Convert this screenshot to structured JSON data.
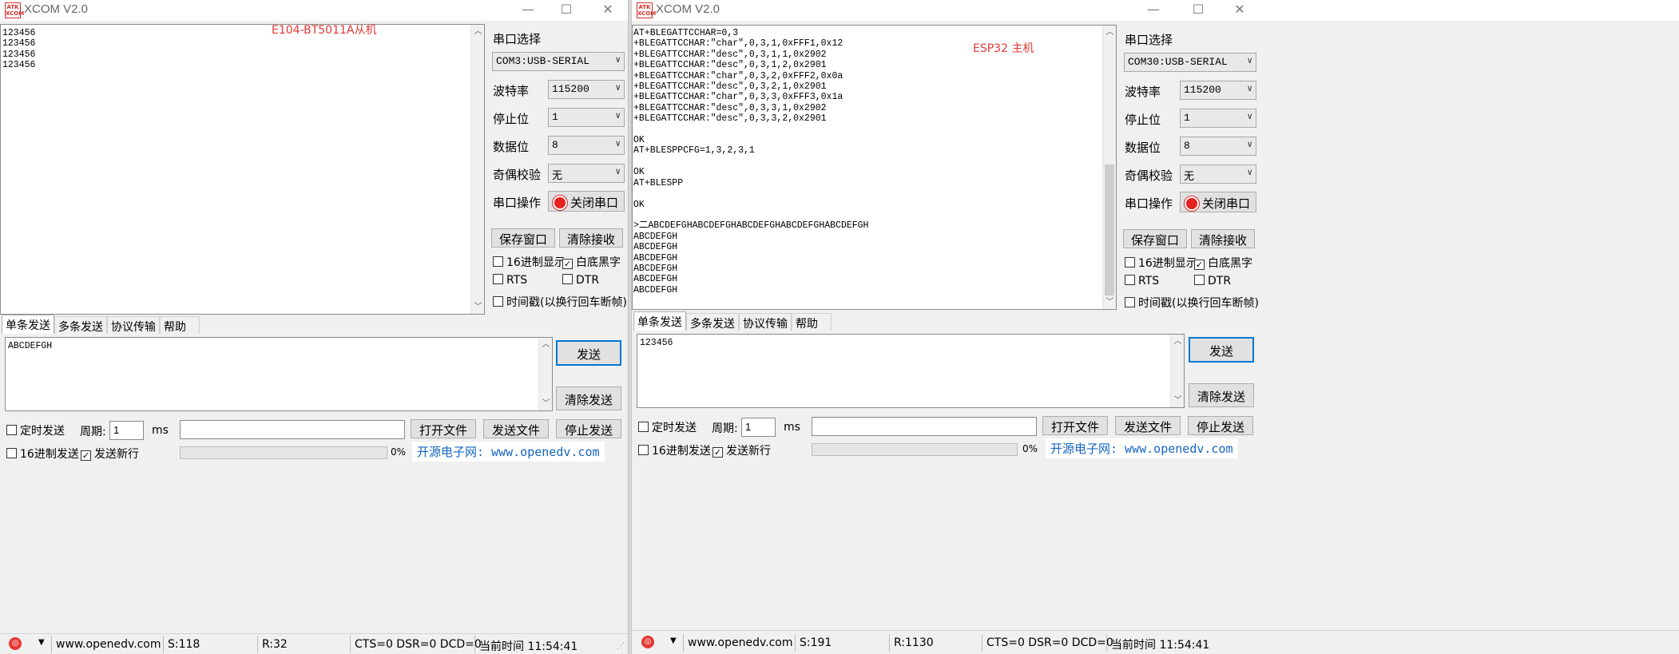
{
  "left": {
    "app": {
      "logo_text": "ATK XCOM",
      "title": "XCOM V2.0"
    },
    "titlebar_buttons": {
      "minimize": "—",
      "maximize": "☐",
      "close": "✕"
    },
    "overlay_label": "E104-BT5011A从机",
    "receive_lines": "123456\n123456\n123456\n123456",
    "settings": {
      "port_label": "串口选择",
      "port_value": "COM3:USB-SERIAL",
      "baud_label": "波特率",
      "baud_value": "115200",
      "stop_label": "停止位",
      "stop_value": "1",
      "data_label": "数据位",
      "data_value": "8",
      "parity_label": "奇偶校验",
      "parity_value": "无",
      "op_label": "串口操作",
      "close_port_label": "关闭串口",
      "save_window": "保存窗口",
      "clear_receive": "清除接收",
      "hex_display": "16进制显示",
      "white_bg": "白底黑字",
      "rts": "RTS",
      "dtr": "DTR",
      "timestamp": "时间戳(以换行回车断帧)"
    },
    "tabs": [
      "单条发送",
      "多条发送",
      "协议传输",
      "帮助"
    ],
    "send_text": "ABCDEFGH",
    "send_button": "发送",
    "clear_send_button": "清除发送",
    "timed_send": "定时发送",
    "period_label": "周期:",
    "period_value": "1",
    "ms": "ms",
    "open_file": "打开文件",
    "send_file": "发送文件",
    "stop_send": "停止发送",
    "hex_send": "16进制发送",
    "send_newline": "发送新行",
    "percent": "0%",
    "site_link": "开源电子网: www.openedv.com",
    "status": {
      "url": "www.openedv.com",
      "s": "S:118",
      "r": "R:32",
      "lines": "CTS=0 DSR=0 DCD=0",
      "time": "当前时间 11:54:41"
    }
  },
  "right": {
    "app": {
      "logo_text": "ATK XCOM",
      "title": "XCOM V2.0"
    },
    "titlebar_buttons": {
      "minimize": "—",
      "maximize": "☐",
      "close": "✕"
    },
    "overlay_label": "ESP32 主机",
    "receive_lines": "AT+BLEGATTCCHAR=0,3\n+BLEGATTCCHAR:\"char\",0,3,1,0xFFF1,0x12\n+BLEGATTCCHAR:\"desc\",0,3,1,1,0x2902\n+BLEGATTCCHAR:\"desc\",0,3,1,2,0x2901\n+BLEGATTCCHAR:\"char\",0,3,2,0xFFF2,0x0a\n+BLEGATTCCHAR:\"desc\",0,3,2,1,0x2901\n+BLEGATTCCHAR:\"char\",0,3,3,0xFFF3,0x1a\n+BLEGATTCCHAR:\"desc\",0,3,3,1,0x2902\n+BLEGATTCCHAR:\"desc\",0,3,3,2,0x2901\n\nOK\nAT+BLESPPCFG=1,3,2,3,1\n\nOK\nAT+BLESPP\n\nOK\n\n>二ABCDEFGHABCDEFGHABCDEFGHABCDEFGHABCDEFGH\nABCDEFGH\nABCDEFGH\nABCDEFGH\nABCDEFGH\nABCDEFGH\nABCDEFGH",
    "settings": {
      "port_label": "串口选择",
      "port_value": "COM30:USB-SERIAL",
      "baud_label": "波特率",
      "baud_value": "115200",
      "stop_label": "停止位",
      "stop_value": "1",
      "data_label": "数据位",
      "data_value": "8",
      "parity_label": "奇偶校验",
      "parity_value": "无",
      "op_label": "串口操作",
      "close_port_label": "关闭串口",
      "save_window": "保存窗口",
      "clear_receive": "清除接收",
      "hex_display": "16进制显示",
      "white_bg": "白底黑字",
      "rts": "RTS",
      "dtr": "DTR",
      "timestamp": "时间戳(以换行回车断帧)"
    },
    "tabs": [
      "单条发送",
      "多条发送",
      "协议传输",
      "帮助"
    ],
    "send_text": "123456",
    "send_button": "发送",
    "clear_send_button": "清除发送",
    "timed_send": "定时发送",
    "period_label": "周期:",
    "period_value": "1",
    "ms": "ms",
    "open_file": "打开文件",
    "send_file": "发送文件",
    "stop_send": "停止发送",
    "hex_send": "16进制发送",
    "send_newline": "发送新行",
    "percent": "0%",
    "site_link": "开源电子网: www.openedv.com",
    "status": {
      "url": "www.openedv.com",
      "s": "S:191",
      "r": "R:1130",
      "lines": "CTS=0 DSR=0 DCD=0",
      "time": "当前时间 11:54:41"
    }
  },
  "colors": {
    "accent": "#0078d7",
    "overlay": "#e53935",
    "link": "#1565c0",
    "led": "#e62121"
  }
}
